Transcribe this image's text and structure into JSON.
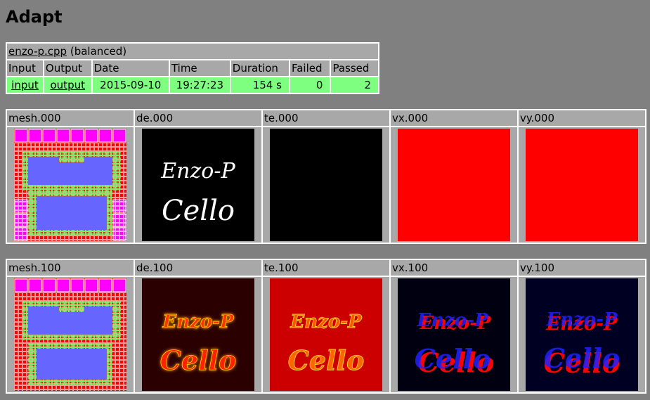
{
  "page": {
    "title": "Adapt"
  },
  "info": {
    "file": "enzo-p.cpp",
    "mode": "(balanced)",
    "headers": [
      "Input",
      "Output",
      "Date",
      "Time",
      "Duration",
      "Failed",
      "Passed"
    ],
    "row": {
      "input": "input",
      "output": "output",
      "date": "2015-09-10",
      "time": "19:27:23",
      "duration": "154 s",
      "failed": "0",
      "passed": "2"
    }
  },
  "images": {
    "row0": [
      "mesh.000",
      "de.000",
      "te.000",
      "vx.000",
      "vy.000"
    ],
    "row1": [
      "mesh.100",
      "de.100",
      "te.100",
      "vx.100",
      "vy.100"
    ]
  },
  "image_text": {
    "line1": "Enzo-P",
    "line2": "Cello"
  },
  "colors": {
    "background": "#808080",
    "header_cell": "#a8a8a8",
    "pass_row": "#7fff7f",
    "mesh_magenta": "#ff00ff",
    "mesh_red": "#ff0000",
    "mesh_green": "#66ff66",
    "mesh_blue": "#6666ff"
  }
}
